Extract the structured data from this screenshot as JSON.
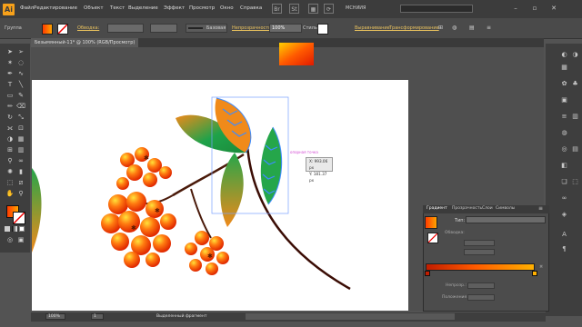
{
  "app": {
    "logo": "Ai",
    "workspace": "МСНИИЯ"
  },
  "menu": [
    "Файл",
    "Редактирование",
    "Объект",
    "Текст",
    "Выделение",
    "Эффект",
    "Просмотр",
    "Окно",
    "Справка"
  ],
  "control": {
    "group_label": "Группа",
    "stroke_label": "Обводка:",
    "brush_label": "Базовая",
    "opacity_label": "Непрозрачность:",
    "opacity_value": "100%",
    "style_label": "Стиль:",
    "align_label": "Выравнивание",
    "transform_label": "Трансформирование"
  },
  "document": {
    "tab_title": "Безымянный-11* @ 100% (RGB/Просмотр)"
  },
  "canvas": {
    "smart_guide": "опорная точка",
    "tooltip_x": "X: 993.06 px",
    "tooltip_y": "Y: 181.37 px"
  },
  "gradient_panel": {
    "tabs": [
      "Градиент",
      "Прозрачность",
      "Слои",
      "Символы"
    ],
    "type_label": "Тип:",
    "stroke_label": "Обводка:",
    "opacity_label": "Непрозр.:",
    "position_label": "Положение:",
    "gradient_colors": [
      "#c21d00",
      "#ff5a00",
      "#ffb000"
    ]
  },
  "status": {
    "zoom": "100%",
    "artboard": "1",
    "text": "Выделенный фрагмент"
  },
  "colors": {
    "accent": "#f7a11a",
    "ui_dark": "#3c3c3c",
    "canvas": "#ffffff"
  }
}
